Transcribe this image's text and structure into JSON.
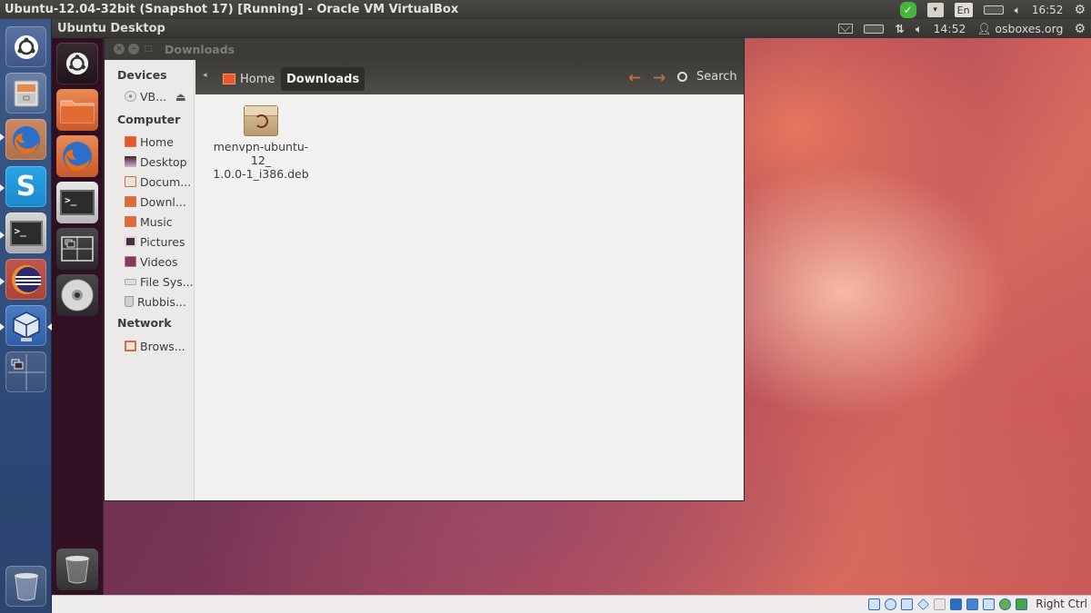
{
  "host": {
    "window_title": "Ubuntu-12.04-32bit (Snapshot 17) [Running] - Oracle VM VirtualBox",
    "indicators": {
      "skype": "skype-online-icon",
      "keyboard": "keyboard-indicator-icon",
      "language": "En",
      "battery": "battery-icon",
      "volume": "volume-icon",
      "time": "16:52",
      "session": "gear-icon"
    },
    "launcher": [
      {
        "name": "dash-home",
        "icon": "ubuntu-logo-icon"
      },
      {
        "name": "file-manager",
        "icon": "file-cabinet-icon"
      },
      {
        "name": "firefox",
        "icon": "firefox-icon"
      },
      {
        "name": "skype",
        "icon": "skype-icon"
      },
      {
        "name": "terminal",
        "icon": "terminal-icon"
      },
      {
        "name": "eclipse",
        "icon": "eclipse-icon"
      },
      {
        "name": "virtualbox",
        "icon": "virtualbox-icon"
      },
      {
        "name": "workspace-switcher",
        "icon": "workspace-switcher-icon"
      },
      {
        "name": "trash",
        "icon": "trash-icon"
      }
    ],
    "statusbar": {
      "icons": [
        "hard-disk-icon",
        "optical-drive-icon",
        "network-icon",
        "usb-icon",
        "shared-folders-icon",
        "display-icon",
        "video-capture-icon",
        "cpu-icon",
        "mouse-integration-icon",
        "keyboard-capture-icon"
      ],
      "host_key": "Right Ctrl"
    }
  },
  "guest": {
    "panel_title": "Ubuntu Desktop",
    "indicators": {
      "mail": "mail-icon",
      "battery": "battery-icon",
      "network": "network-updown-icon",
      "volume": "volume-icon",
      "time": "14:52",
      "user": "osboxes.org",
      "session": "gear-icon"
    },
    "launcher": [
      {
        "name": "dash-home",
        "icon": "ubuntu-logo-icon"
      },
      {
        "name": "files",
        "icon": "folder-icon"
      },
      {
        "name": "firefox",
        "icon": "firefox-icon"
      },
      {
        "name": "terminal",
        "icon": "terminal-icon"
      },
      {
        "name": "workspace-switcher",
        "icon": "workspace-switcher-icon"
      },
      {
        "name": "vbox-cd",
        "icon": "cd-icon"
      },
      {
        "name": "trash",
        "icon": "trash-icon"
      }
    ]
  },
  "nautilus": {
    "title": "Downloads",
    "window_buttons": {
      "close": "×",
      "minimize": "–",
      "maximize": "□"
    },
    "sidebar": {
      "devices_label": "Devices",
      "devices": [
        {
          "label": "VB...",
          "icon": "cd-icon",
          "eject": "⏏"
        }
      ],
      "computer_label": "Computer",
      "computer": [
        {
          "label": "Home",
          "icon": "home-folder-icon"
        },
        {
          "label": "Desktop",
          "icon": "desktop-icon"
        },
        {
          "label": "Docum...",
          "icon": "documents-folder-icon"
        },
        {
          "label": "Downl...",
          "icon": "downloads-folder-icon"
        },
        {
          "label": "Music",
          "icon": "music-folder-icon"
        },
        {
          "label": "Pictures",
          "icon": "pictures-folder-icon"
        },
        {
          "label": "Videos",
          "icon": "videos-folder-icon"
        },
        {
          "label": "File Sys...",
          "icon": "filesystem-icon"
        },
        {
          "label": "Rubbis...",
          "icon": "trash-icon"
        }
      ],
      "network_label": "Network",
      "network": [
        {
          "label": "Brows...",
          "icon": "network-folder-icon"
        }
      ]
    },
    "toolbar": {
      "breadcrumbs": [
        "Home",
        "Downloads"
      ],
      "back": "←",
      "forward": "→",
      "search_label": "Search"
    },
    "files": [
      {
        "name": "menvpn-ubuntu-12_\n1.0.0-1_i386.deb",
        "line1": "menvpn-ubuntu-12_",
        "line2": "1.0.0-1_i386.deb",
        "icon": "debian-package-icon"
      }
    ]
  }
}
